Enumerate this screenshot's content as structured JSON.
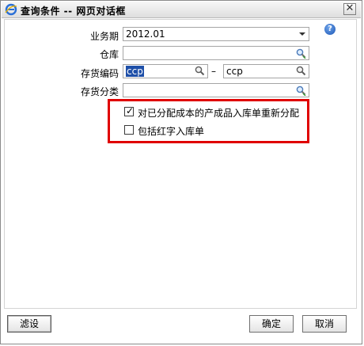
{
  "window": {
    "title": "查询条件 -- 网页对话框",
    "close_symbol": "✕"
  },
  "help": {
    "symbol": "?"
  },
  "form": {
    "period": {
      "label": "业务期",
      "value": "2012.01"
    },
    "warehouse": {
      "label": "仓库",
      "value": ""
    },
    "code": {
      "label": "存货编码",
      "from_value": "ccp",
      "separator": "–",
      "to_value": "ccp"
    },
    "category": {
      "label": "存货分类",
      "value": ""
    }
  },
  "options": {
    "reallocate": {
      "label": "对已分配成本的产成品入库单重新分配",
      "checked": true,
      "mark": "✓"
    },
    "include_red": {
      "label": "包括红字入库单",
      "checked": false
    }
  },
  "buttons": {
    "filter": "滤设",
    "ok": "确定",
    "cancel": "取消"
  },
  "colors": {
    "highlight": "#e00000",
    "selection": "#1e4fa8"
  }
}
